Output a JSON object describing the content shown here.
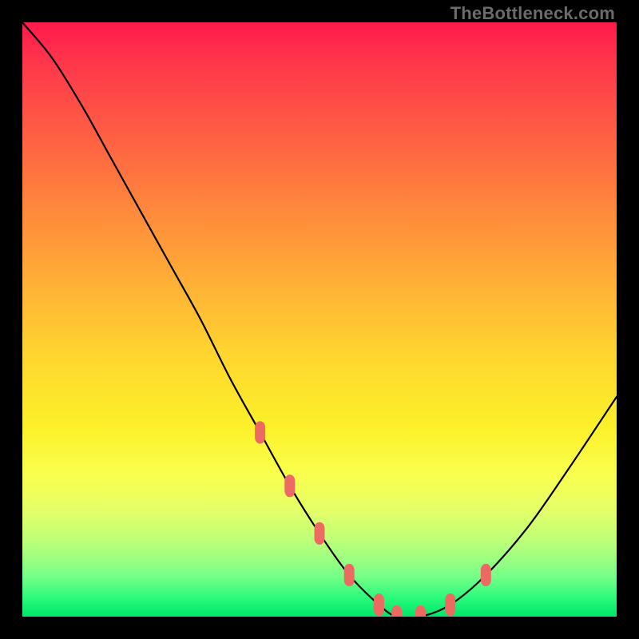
{
  "watermark": "TheBottleneck.com",
  "chart_data": {
    "type": "line",
    "title": "",
    "xlabel": "",
    "ylabel": "",
    "x": [
      0.0,
      0.05,
      0.1,
      0.15,
      0.2,
      0.25,
      0.3,
      0.35,
      0.4,
      0.45,
      0.5,
      0.55,
      0.6,
      0.63,
      0.67,
      0.72,
      0.78,
      0.85,
      0.92,
      1.0
    ],
    "values": [
      1.0,
      0.94,
      0.86,
      0.77,
      0.68,
      0.59,
      0.5,
      0.4,
      0.31,
      0.22,
      0.14,
      0.07,
      0.02,
      0.0,
      0.0,
      0.02,
      0.07,
      0.15,
      0.25,
      0.37
    ],
    "xlim": [
      0,
      1
    ],
    "ylim": [
      0,
      1
    ],
    "markers_indices": [
      8,
      9,
      10,
      11,
      12,
      13,
      14,
      15,
      16
    ],
    "marker_color": "#ec6a62",
    "curve_color": "#000000",
    "background_gradient": [
      "#ff1a4d",
      "#ffd62f",
      "#00e66b"
    ],
    "frame_color": "#000000"
  }
}
